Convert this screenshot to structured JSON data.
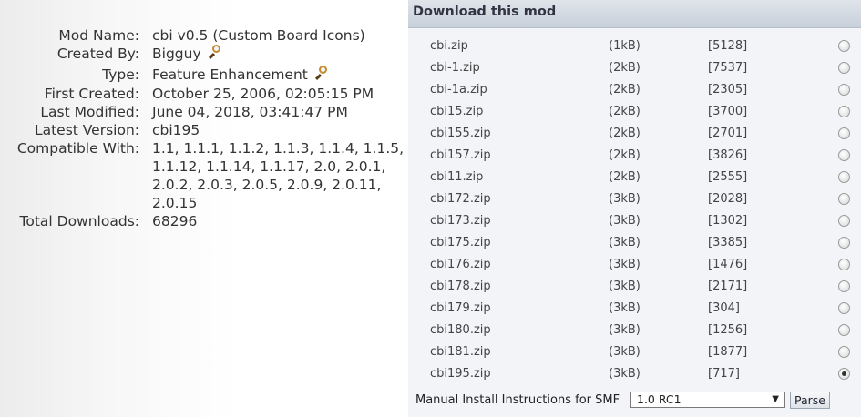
{
  "info": {
    "rows": [
      {
        "label": "Mod Name:",
        "value": "cbi v0.5 (Custom Board Icons)"
      },
      {
        "label": "Created By:",
        "value": "Bigguy"
      },
      {
        "label": "Type:",
        "value": "Feature Enhancement"
      },
      {
        "label": "First Created:",
        "value": "October 25, 2006, 02:05:15 PM"
      },
      {
        "label": "Last Modified:",
        "value": "June 04, 2018, 03:41:47 PM"
      },
      {
        "label": "Latest Version:",
        "value": "cbi195"
      },
      {
        "label": "Compatible With:",
        "value": "1.1, 1.1.1, 1.1.2, 1.1.3, 1.1.4, 1.1.5, 1.1.12, 1.1.14, 1.1.17, 2.0, 2.0.1, 2.0.2, 2.0.3, 2.0.5, 2.0.9, 2.0.11, 2.0.15"
      },
      {
        "label": "Total Downloads:",
        "value": "68296"
      }
    ],
    "icons": {
      "search": "magnifier-icon"
    }
  },
  "download": {
    "title": "Download this mod",
    "files": [
      {
        "name": "cbi.zip",
        "size": "(1kB)",
        "count": "[5128]",
        "selected": false
      },
      {
        "name": "cbi-1.zip",
        "size": "(2kB)",
        "count": "[7537]",
        "selected": false
      },
      {
        "name": "cbi-1a.zip",
        "size": "(2kB)",
        "count": "[2305]",
        "selected": false
      },
      {
        "name": "cbi15.zip",
        "size": "(2kB)",
        "count": "[3700]",
        "selected": false
      },
      {
        "name": "cbi155.zip",
        "size": "(2kB)",
        "count": "[2701]",
        "selected": false
      },
      {
        "name": "cbi157.zip",
        "size": "(2kB)",
        "count": "[3826]",
        "selected": false
      },
      {
        "name": "cbi11.zip",
        "size": "(2kB)",
        "count": "[2555]",
        "selected": false
      },
      {
        "name": "cbi172.zip",
        "size": "(3kB)",
        "count": "[2028]",
        "selected": false
      },
      {
        "name": "cbi173.zip",
        "size": "(3kB)",
        "count": "[1302]",
        "selected": false
      },
      {
        "name": "cbi175.zip",
        "size": "(3kB)",
        "count": "[3385]",
        "selected": false
      },
      {
        "name": "cbi176.zip",
        "size": "(3kB)",
        "count": "[1476]",
        "selected": false
      },
      {
        "name": "cbi178.zip",
        "size": "(3kB)",
        "count": "[2171]",
        "selected": false
      },
      {
        "name": "cbi179.zip",
        "size": "(3kB)",
        "count": "[304]",
        "selected": false
      },
      {
        "name": "cbi180.zip",
        "size": "(3kB)",
        "count": "[1256]",
        "selected": false
      },
      {
        "name": "cbi181.zip",
        "size": "(3kB)",
        "count": "[1877]",
        "selected": false
      },
      {
        "name": "cbi195.zip",
        "size": "(3kB)",
        "count": "[717]",
        "selected": true
      }
    ],
    "footer": {
      "label": "Manual Install Instructions for SMF",
      "select_value": "1.0 RC1",
      "select_arrow": "▼",
      "parse_label": "Parse"
    }
  },
  "colors": {
    "header_bg": "#c8d0da",
    "panel_bg": "#f2f4f7",
    "text": "#333333"
  }
}
